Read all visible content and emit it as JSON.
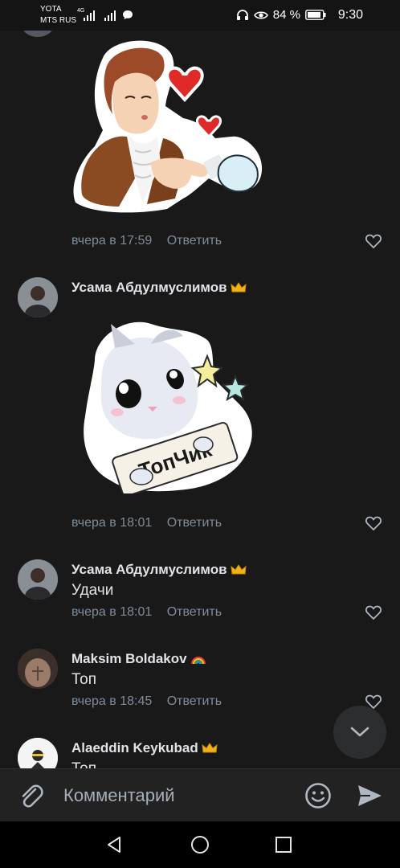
{
  "status_bar": {
    "carrier1": "YOTA",
    "carrier2": "MTS RUS",
    "network": "4G",
    "battery": "84 %",
    "time": "9:30"
  },
  "comments": [
    {
      "id": "c1",
      "author": "",
      "sticker": "boy-kiss-sticker",
      "time": "вчера в 17:59",
      "reply_label": "Ответить"
    },
    {
      "id": "c2",
      "author": "Усама Абдулмуслимов",
      "badge": "crown",
      "sticker": "cat-topchik-sticker",
      "sticker_text": "ТопЧик",
      "time": "вчера в 18:01",
      "reply_label": "Ответить"
    },
    {
      "id": "c3",
      "author": "Усама Абдулмуслимов",
      "badge": "crown",
      "text": "Удачи",
      "time": "вчера в 18:01",
      "reply_label": "Ответить"
    },
    {
      "id": "c4",
      "author": "Maksim Boldakov",
      "badge": "rainbow",
      "text": "Топ",
      "time": "вчера в 18:45",
      "reply_label": "Ответить"
    },
    {
      "id": "c5",
      "author": "Alaeddin Keykubad",
      "badge": "crown",
      "text": "Топ"
    }
  ],
  "composer": {
    "placeholder": "Комментарий"
  },
  "colors": {
    "background": "#19191a",
    "text_primary": "#e1e3e6",
    "text_secondary": "#818c99"
  }
}
